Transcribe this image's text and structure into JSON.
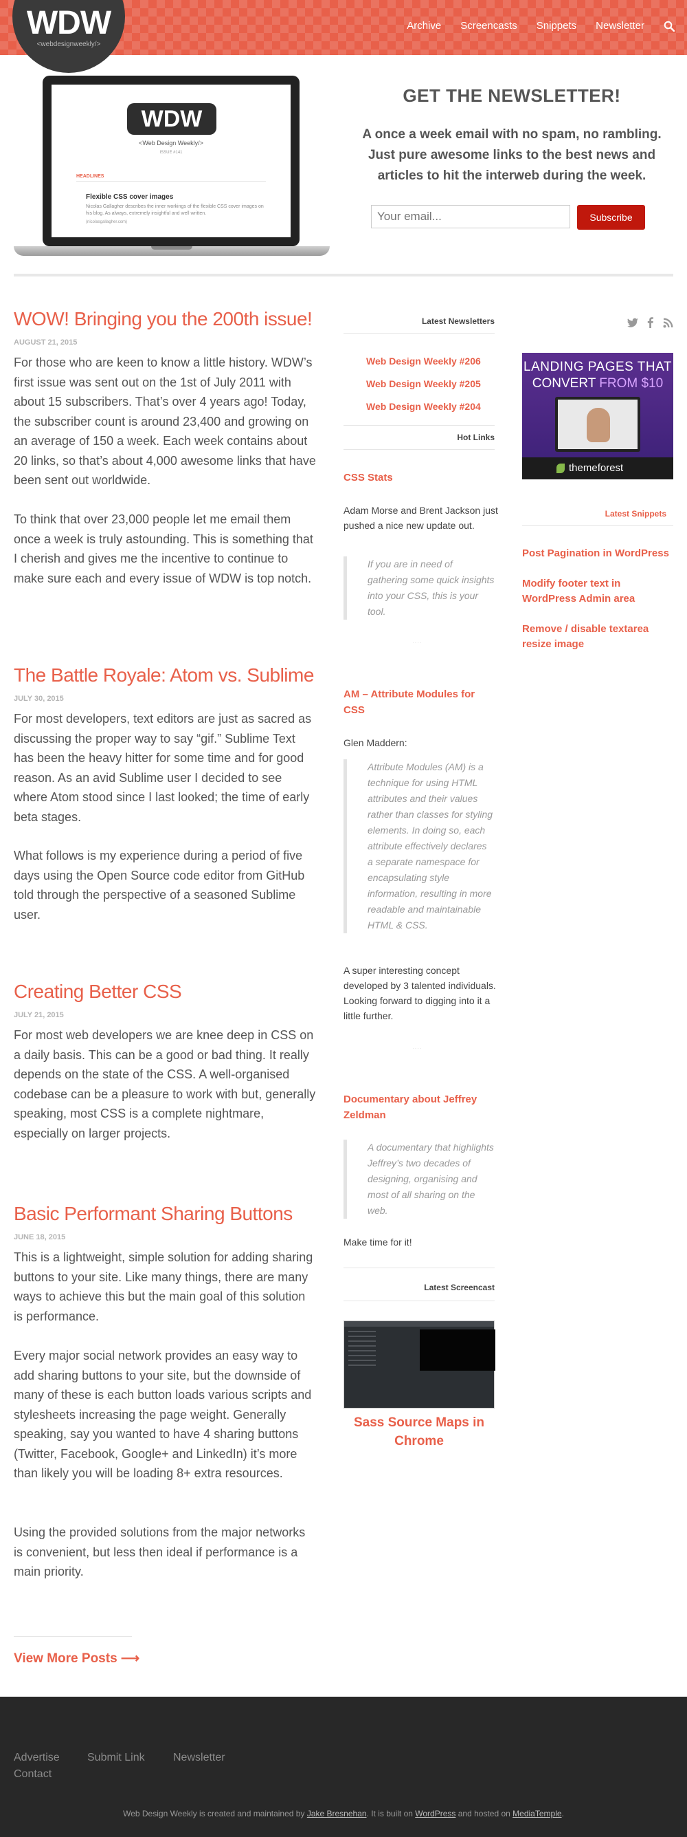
{
  "header": {
    "logo_text": "WDW",
    "logo_sub": "<webdesignweekly/>",
    "nav": [
      "Archive",
      "Screencasts",
      "Snippets",
      "Newsletter"
    ],
    "search_icon": "search-icon"
  },
  "hero": {
    "laptop": {
      "logo": "WDW",
      "tagline": "<Web Design Weekly/>",
      "issue": "ISSUE #141",
      "section": "HEADLINES",
      "article_title": "Flexible CSS cover images",
      "article_desc": "Nicolas Gallagher describes the inner workings of the flexible CSS cover images on his blog. As always, extremely insightful and well written.",
      "article_link": "(nicolasgallagher.com)"
    },
    "newsletter": {
      "title": "GET THE NEWSLETTER!",
      "text": "A once a week email with no spam, no rambling. Just pure awesome links to the best news and articles to hit the interweb during the week.",
      "placeholder": "Your email...",
      "button": "Subscribe"
    }
  },
  "posts": [
    {
      "title": "WOW! Bringing you the 200th issue!",
      "date": "AUGUST 21, 2015",
      "paragraphs": [
        "For those who are keen to know a little history. WDW’s first issue was sent out on the 1st of July 2011 with about 15 subscribers. That’s over 4 years ago! Today, the subscriber count is around 23,400 and growing on an average of 150 a week. Each week contains about 20 links, so that’s about 4,000 awesome links that have been sent out worldwide.",
        "To think that over 23,000 people let me email them once a week is truly astounding. This is something that I cherish and gives me the incentive to continue to make sure each and every issue of WDW is top notch."
      ]
    },
    {
      "title": "The Battle Royale: Atom vs. Sublime",
      "date": "JULY 30, 2015",
      "paragraphs": [
        "For most developers, text editors are just as sacred as discussing the proper way to say “gif.” Sublime Text has been the heavy hitter for some time and for good reason. As an avid Sublime user I decided to see where Atom stood since I last looked; the time of early beta stages.",
        "What follows is my experience during a period of five days using the Open Source code editor from GitHub told through the perspective of a seasoned Sublime user."
      ]
    },
    {
      "title": "Creating Better CSS",
      "date": "JULY 21, 2015",
      "paragraphs": [
        "For most web developers we are knee deep in CSS on a daily basis. This can be a good or bad thing. It really depends on the state of the CSS. A well-organised codebase can be a pleasure to work with but, generally speaking, most CSS is a complete nightmare, especially on larger projects."
      ]
    },
    {
      "title": "Basic Performant Sharing Buttons",
      "date": "JUNE 18, 2015",
      "paragraphs": [
        "This is a lightweight, simple solution for adding sharing buttons to your site. Like many things, there are many ways to achieve this but the main goal of this solution is performance.",
        "Every major social network provides an easy way to add sharing buttons to your site, but the downside of many of these is each button loads various scripts and stylesheets increasing the page weight. Generally speaking, say you wanted to have 4 sharing buttons (Twitter, Facebook, Google+ and LinkedIn) it’s more than likely you will be loading 8+ extra resources.",
        "Using the provided solutions from the major networks is convenient, but less then ideal if performance is a main priority."
      ]
    }
  ],
  "more_posts": "View More Posts ⟶",
  "sidebar": {
    "latest_newsletters_title": "Latest Newsletters",
    "newsletters": [
      "Web Design Weekly #206",
      "Web Design Weekly #205",
      "Web Design Weekly #204"
    ],
    "hot_links_title": "Hot Links",
    "hot_links": [
      {
        "title": "CSS Stats",
        "intro": "Adam Morse and Brent Jackson just pushed a nice new update out.",
        "quote": "If you are in need of gathering some quick insights into your CSS, this is your tool.",
        "after": ""
      },
      {
        "title": "AM – Attribute Modules for CSS",
        "intro": "Glen Maddern:",
        "quote": "Attribute Modules (AM) is a technique for using HTML attributes and their values rather than classes for styling elements. In doing so, each attribute effectively declares a separate namespace for encapsulating style information, resulting in more readable and maintainable HTML & CSS.",
        "after": "A super interesting concept developed by 3 talented individuals. Looking forward to digging into it a little further."
      },
      {
        "title": "Documentary about Jeffrey Zeldman",
        "intro": "",
        "quote": "A documentary that highlights Jeffrey’s two decades of designing, organising and most of all sharing on the web.",
        "after": "Make time for it!"
      }
    ],
    "separator": "····",
    "latest_screencast_title": "Latest Screencast",
    "screencast_title": "Sass Source Maps in Chrome"
  },
  "right": {
    "social_icons": [
      "twitter-icon",
      "facebook-icon",
      "rss-icon"
    ],
    "ad": {
      "line1": "LANDING PAGES THAT",
      "line2_prefix": "CONVERT",
      "line2_accent": "FROM $10",
      "brand": "themeforest"
    },
    "latest_snippets_title": "Latest Snippets",
    "snippets": [
      "Post Pagination in WordPress",
      "Modify footer text in WordPress Admin area",
      "Remove / disable textarea resize image"
    ]
  },
  "footer": {
    "links": [
      "Advertise",
      "Submit Link",
      "Newsletter",
      "Contact"
    ],
    "credit_prefix": "Web Design Weekly is created and maintained by",
    "credit_author": "Jake Bresnehan",
    "credit_mid": ". It is built on",
    "credit_wp": "WordPress",
    "credit_and": "and hosted on",
    "credit_host": "MediaTemple",
    "credit_end": "."
  },
  "colors": {
    "accent": "#e8604a",
    "button": "#c0180c",
    "footer": "#282828"
  }
}
